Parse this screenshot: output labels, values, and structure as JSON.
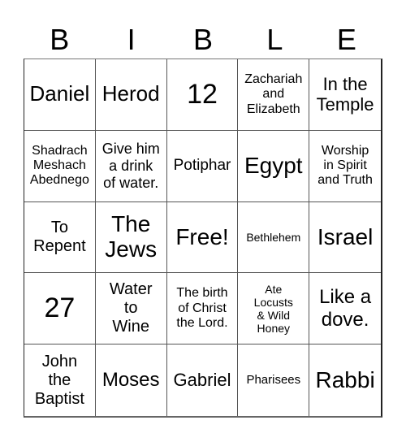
{
  "header": {
    "letters": [
      "B",
      "I",
      "B",
      "L",
      "E"
    ]
  },
  "cells": [
    "Daniel",
    "Herod",
    "12",
    "Zachariah\nand\nElizabeth",
    "In the\nTemple",
    "Shadrach\nMeshach\nAbednego",
    "Give him\na drink\nof water.",
    "Potiphar",
    "Egypt",
    "Worship\nin Spirit\nand Truth",
    "To\nRepent",
    "The\nJews",
    "Free!",
    "Bethlehem",
    "Israel",
    "27",
    "Water\nto\nWine",
    "The birth\nof Christ\nthe Lord.",
    "Ate\nLocusts\n& Wild\nHoney",
    "Like a\ndove.",
    "John\nthe\nBaptist",
    "Moses",
    "Gabriel",
    "Pharisees",
    "Rabbi"
  ]
}
